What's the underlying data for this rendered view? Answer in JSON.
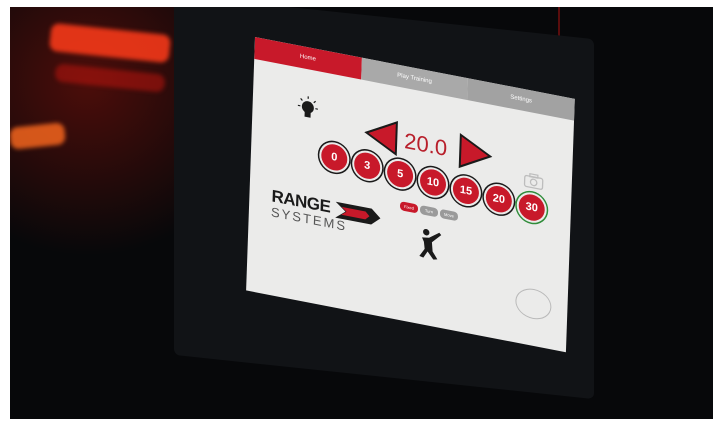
{
  "tabs": [
    {
      "label": "Home",
      "active": true
    },
    {
      "label": "Play Training",
      "active": false
    },
    {
      "label": "Settings",
      "active": false
    }
  ],
  "distance_value": "20.0",
  "distance_buttons": [
    "0",
    "3",
    "5",
    "10",
    "15",
    "20",
    "30"
  ],
  "mode_buttons": [
    "Fixed",
    "Turn",
    "Move"
  ],
  "brand": {
    "line1": "RANGE",
    "line2": "SYSTEMS"
  },
  "badge_text": "",
  "colors": {
    "accent": "#c8192a",
    "screen_bg": "#ebebea",
    "tab_inactive": "#a9a9a9",
    "ring_last": "#2f8c3a"
  },
  "icons": [
    "bulb-icon",
    "left-arrow-icon",
    "right-arrow-icon",
    "camera-icon",
    "person-icon"
  ]
}
